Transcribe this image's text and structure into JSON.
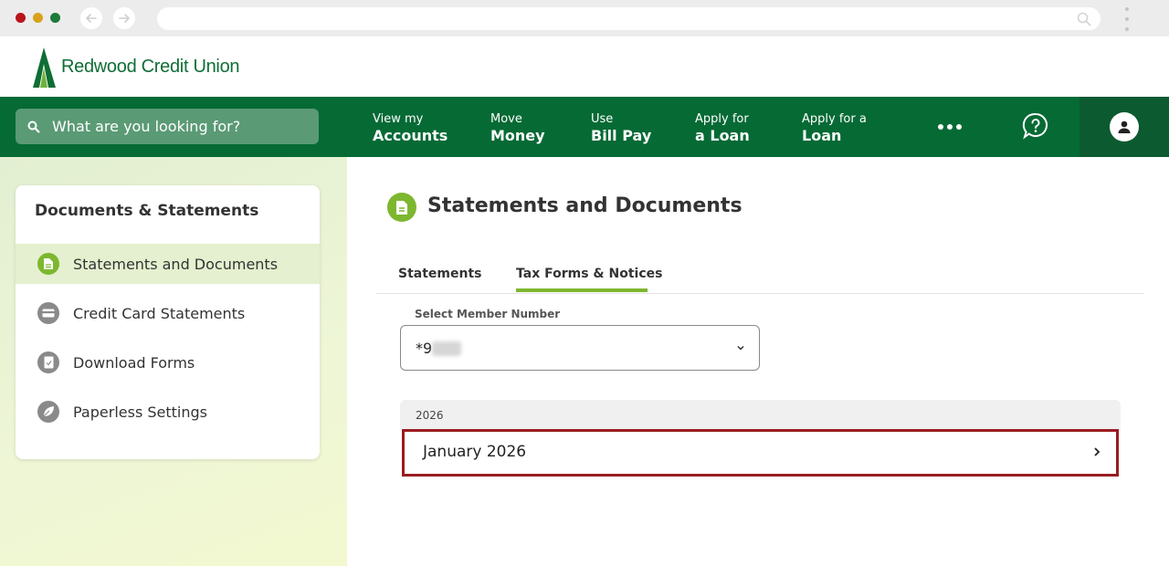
{
  "brand": {
    "name": "Redwood Credit Union",
    "primary_color": "#066a35",
    "accent_color": "#7db72f",
    "highlight_color": "#9a1c20"
  },
  "search": {
    "placeholder": "What are you looking for?"
  },
  "nav": {
    "items": [
      {
        "line1": "View my",
        "line2": "Accounts"
      },
      {
        "line1": "Move",
        "line2": "Money"
      },
      {
        "line1": "Use",
        "line2": "Bill Pay"
      },
      {
        "line1": "Apply for",
        "line2": "a Loan"
      },
      {
        "line1": "Apply for a",
        "line2": "Loan"
      }
    ],
    "icons": [
      "more-icon",
      "help-chat-icon",
      "profile-icon"
    ]
  },
  "sidebar": {
    "title": "Documents & Statements",
    "items": [
      {
        "label": "Statements and Documents",
        "icon": "document-icon",
        "active": true
      },
      {
        "label": "Credit Card Statements",
        "icon": "credit-card-icon",
        "active": false
      },
      {
        "label": "Download Forms",
        "icon": "form-icon",
        "active": false
      },
      {
        "label": "Paperless Settings",
        "icon": "leaf-icon",
        "active": false
      }
    ]
  },
  "main": {
    "title": "Statements and Documents",
    "tabs": [
      {
        "label": "Statements",
        "active": false
      },
      {
        "label": "Tax Forms & Notices",
        "active": true
      }
    ],
    "member_select": {
      "label": "Select Member Number",
      "value": "*9"
    },
    "year_group": {
      "year": "2026",
      "documents": [
        {
          "label": "January 2026",
          "highlighted": true
        }
      ]
    }
  }
}
